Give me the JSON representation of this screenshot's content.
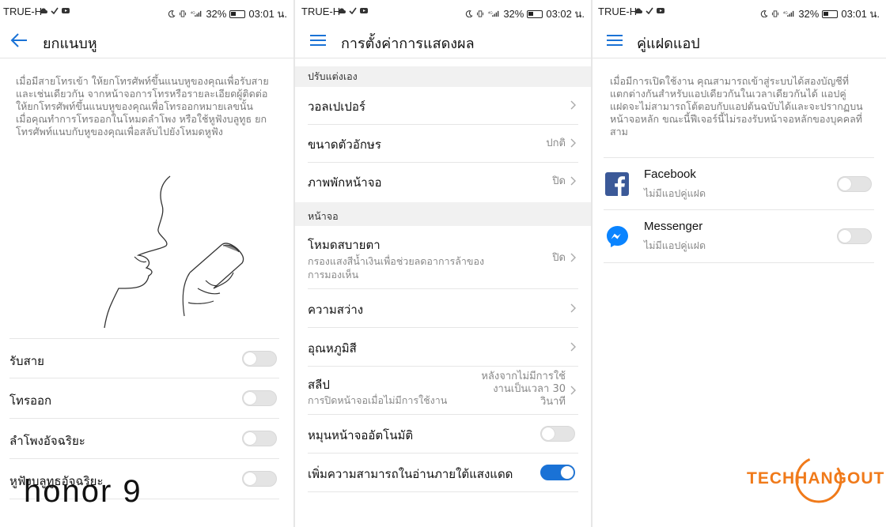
{
  "status_bars": [
    {
      "carrier": "TRUE-H",
      "battery": "32%",
      "time": "03:01 น."
    },
    {
      "carrier": "TRUE-H",
      "battery": "32%",
      "time": "03:02 น."
    },
    {
      "carrier": "TRUE-H",
      "battery": "32%",
      "time": "03:01 น."
    }
  ],
  "pocket_mode": {
    "title": "ยกแนบหู",
    "description": "เมื่อมีสายโทรเข้า ให้ยกโทรศัพท์ขึ้นแนบหูของคุณเพื่อรับสาย และเช่นเดียวกัน จากหน้าจอการโทรหรือรายละเอียดผู้ติดต่อ ให้ยกโทรศัพท์ขึ้นแนบหูของคุณเพื่อโทรออกหมายเลขนั้น เมื่อคุณทำการโทรออกในโหมดลำโพง หรือใช้หูฟังบลูทูธ ยกโทรศัพท์แนบกับหูของคุณเพื่อสลับไปยังโหมดหูฟัง",
    "options": [
      {
        "label": "รับสาย",
        "on": false
      },
      {
        "label": "โทรออก",
        "on": false
      },
      {
        "label": "ลำโพงอัจฉริยะ",
        "on": false
      },
      {
        "label": "หูฟังบลูทูธอัจฉริยะ",
        "on": false
      }
    ]
  },
  "display_settings": {
    "title": "การตั้งค่าการแสดงผล",
    "section_personal": "ปรับแต่งเอง",
    "wallpaper": "วอลเปเปอร์",
    "font_size": {
      "label": "ขนาดตัวอักษร",
      "value": "ปกติ"
    },
    "screensaver": {
      "label": "ภาพพักหน้าจอ",
      "value": "ปิด"
    },
    "section_screen": "หน้าจอ",
    "eye_comfort": {
      "label": "โหมดสบายตา",
      "sub": "กรองแสงสีน้ำเงินเพื่อช่วยลดอาการล้าของการมองเห็น",
      "value": "ปิด"
    },
    "brightness": "ความสว่าง",
    "color_temp": "อุณหภูมิสี",
    "sleep": {
      "label": "สลีป",
      "sub": "การปิดหน้าจอเมื่อไม่มีการใช้งาน",
      "value": "หลังจากไม่มีการใช้งานเป็นเวลา 30 วินาที"
    },
    "auto_rotate": {
      "label": "หมุนหน้าจออัตโนมัติ",
      "on": false
    },
    "sunlight": {
      "label": "เพิ่มความสามารถในอ่านภายใต้แสงแดด",
      "on": true
    }
  },
  "app_twin": {
    "title": "คู่แฝดแอป",
    "description": "เมื่อมีการเปิดใช้งาน คุณสามารถเข้าสู่ระบบได้สองบัญชีที่แตกต่างกันสำหรับแอปเดียวกันในเวลาเดียวกันได้ แอปคู่แฝดจะไม่สามารถโต้ตอบกับแอปต้นฉบับได้และจะปรากฏบนหน้าจอหลัก ขณะนี้ฟีเจอร์นี้ไม่รองรับหน้าจอหลักของบุคคลที่สาม",
    "apps": [
      {
        "name": "Facebook",
        "sub": "ไม่มีแอปคู่แฝด",
        "on": false
      },
      {
        "name": "Messenger",
        "sub": "ไม่มีแอปคู่แฝด",
        "on": false
      }
    ]
  },
  "watermarks": {
    "device": "honor 9",
    "site": "TECHHANGOUT"
  },
  "colors": {
    "accent": "#1a72d6",
    "facebook": "#3b5998",
    "messenger": "#0a84ff"
  }
}
